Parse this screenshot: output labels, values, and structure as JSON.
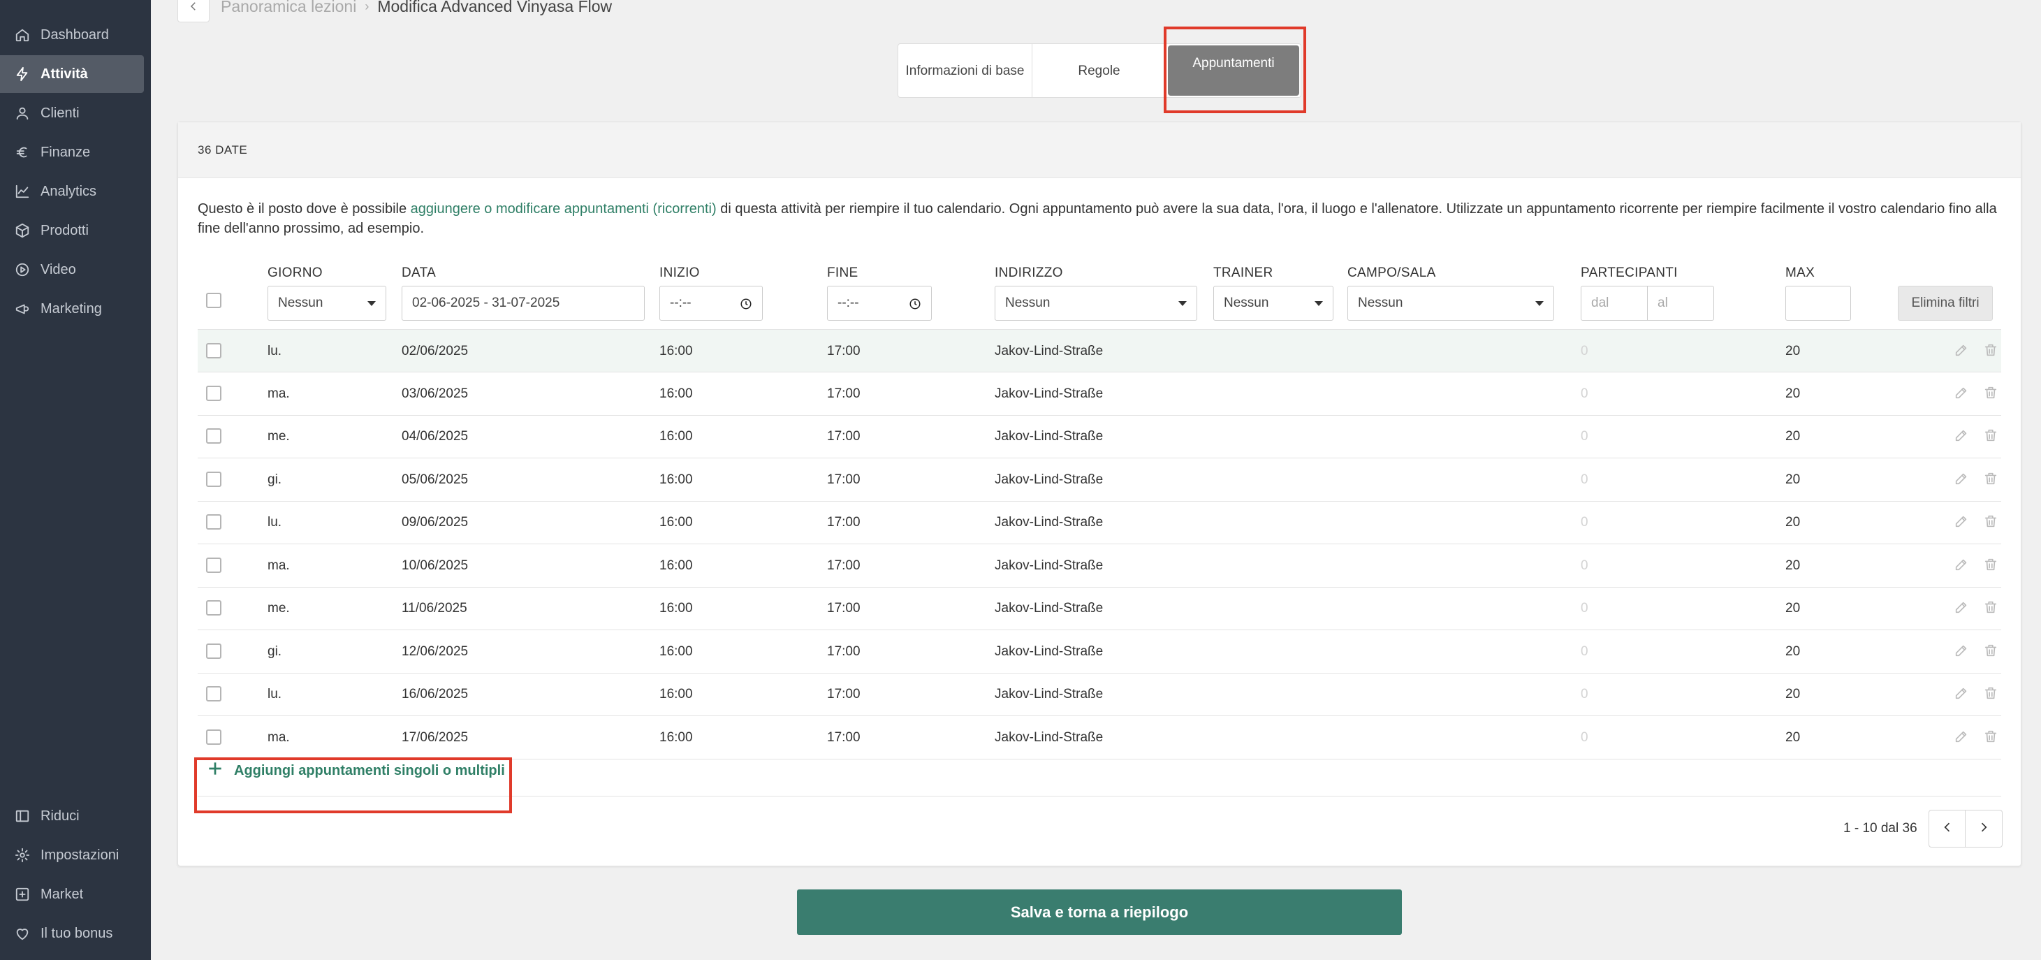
{
  "sidebar": {
    "items": [
      {
        "label": "Dashboard",
        "icon": "home-icon"
      },
      {
        "label": "Attività",
        "icon": "bolt-icon"
      },
      {
        "label": "Clienti",
        "icon": "user-icon"
      },
      {
        "label": "Finanze",
        "icon": "euro-icon"
      },
      {
        "label": "Analytics",
        "icon": "chart-line-icon"
      },
      {
        "label": "Prodotti",
        "icon": "box-icon"
      },
      {
        "label": "Video",
        "icon": "play-circle-icon"
      },
      {
        "label": "Marketing",
        "icon": "megaphone-icon"
      }
    ],
    "bottom_items": [
      {
        "label": "Riduci",
        "icon": "collapse-icon"
      },
      {
        "label": "Impostazioni",
        "icon": "gear-icon"
      },
      {
        "label": "Market",
        "icon": "plus-square-icon"
      },
      {
        "label": "Il tuo bonus",
        "icon": "heart-icon"
      }
    ]
  },
  "breadcrumb": {
    "parent": "Panoramica lezioni",
    "current": "Modifica Advanced Vinyasa Flow"
  },
  "tabs": [
    {
      "label": "Informazioni di base"
    },
    {
      "label": "Regole"
    },
    {
      "label": "Appuntamenti"
    }
  ],
  "card": {
    "title": "36 DATE",
    "desc_before": "Questo è il posto dove è possibile ",
    "desc_link": "aggiungere o modificare appuntamenti (ricorrenti)",
    "desc_after": " di questa attività per riempire il tuo calendario. Ogni appuntamento può avere la sua data, l'ora, il luogo e l'allenatore. Utilizzate un appuntamento ricorrente per riempire facilmente il vostro calendario fino alla fine dell'anno prossimo, ad esempio."
  },
  "columns": {
    "giorno": "GIORNO",
    "data": "DATA",
    "inizio": "INIZIO",
    "fine": "FINE",
    "indirizzo": "INDIRIZZO",
    "trainer": "TRAINER",
    "campo": "CAMPO/SALA",
    "partecipanti": "PARTECIPANTI",
    "max": "MAX"
  },
  "filters": {
    "giorno": "Nessun",
    "data": "02-06-2025 - 31-07-2025",
    "inizio": "--:--",
    "fine": "--:--",
    "indirizzo": "Nessun",
    "trainer": "Nessun",
    "campo": "Nessun",
    "part_from_placeholder": "dal",
    "part_to_placeholder": "al",
    "max": "",
    "clear_label": "Elimina filtri"
  },
  "rows": [
    {
      "day": "lu.",
      "date": "02/06/2025",
      "start": "16:00",
      "end": "17:00",
      "address": "Jakov-Lind-Straße",
      "participants": "0",
      "max": "20"
    },
    {
      "day": "ma.",
      "date": "03/06/2025",
      "start": "16:00",
      "end": "17:00",
      "address": "Jakov-Lind-Straße",
      "participants": "0",
      "max": "20"
    },
    {
      "day": "me.",
      "date": "04/06/2025",
      "start": "16:00",
      "end": "17:00",
      "address": "Jakov-Lind-Straße",
      "participants": "0",
      "max": "20"
    },
    {
      "day": "gi.",
      "date": "05/06/2025",
      "start": "16:00",
      "end": "17:00",
      "address": "Jakov-Lind-Straße",
      "participants": "0",
      "max": "20"
    },
    {
      "day": "lu.",
      "date": "09/06/2025",
      "start": "16:00",
      "end": "17:00",
      "address": "Jakov-Lind-Straße",
      "participants": "0",
      "max": "20"
    },
    {
      "day": "ma.",
      "date": "10/06/2025",
      "start": "16:00",
      "end": "17:00",
      "address": "Jakov-Lind-Straße",
      "participants": "0",
      "max": "20"
    },
    {
      "day": "me.",
      "date": "11/06/2025",
      "start": "16:00",
      "end": "17:00",
      "address": "Jakov-Lind-Straße",
      "participants": "0",
      "max": "20"
    },
    {
      "day": "gi.",
      "date": "12/06/2025",
      "start": "16:00",
      "end": "17:00",
      "address": "Jakov-Lind-Straße",
      "participants": "0",
      "max": "20"
    },
    {
      "day": "lu.",
      "date": "16/06/2025",
      "start": "16:00",
      "end": "17:00",
      "address": "Jakov-Lind-Straße",
      "participants": "0",
      "max": "20"
    },
    {
      "day": "ma.",
      "date": "17/06/2025",
      "start": "16:00",
      "end": "17:00",
      "address": "Jakov-Lind-Straße",
      "participants": "0",
      "max": "20"
    }
  ],
  "add_label": "Aggiungi appuntamenti singoli o multipli",
  "pagination": {
    "label": "1 - 10 dal 36"
  },
  "save_label": "Salva e torna a riepilogo",
  "colors": {
    "sidebar": "#2c3441",
    "accent": "#3a7d6f",
    "link": "#2f7f66",
    "highlight": "#e03a2a"
  }
}
